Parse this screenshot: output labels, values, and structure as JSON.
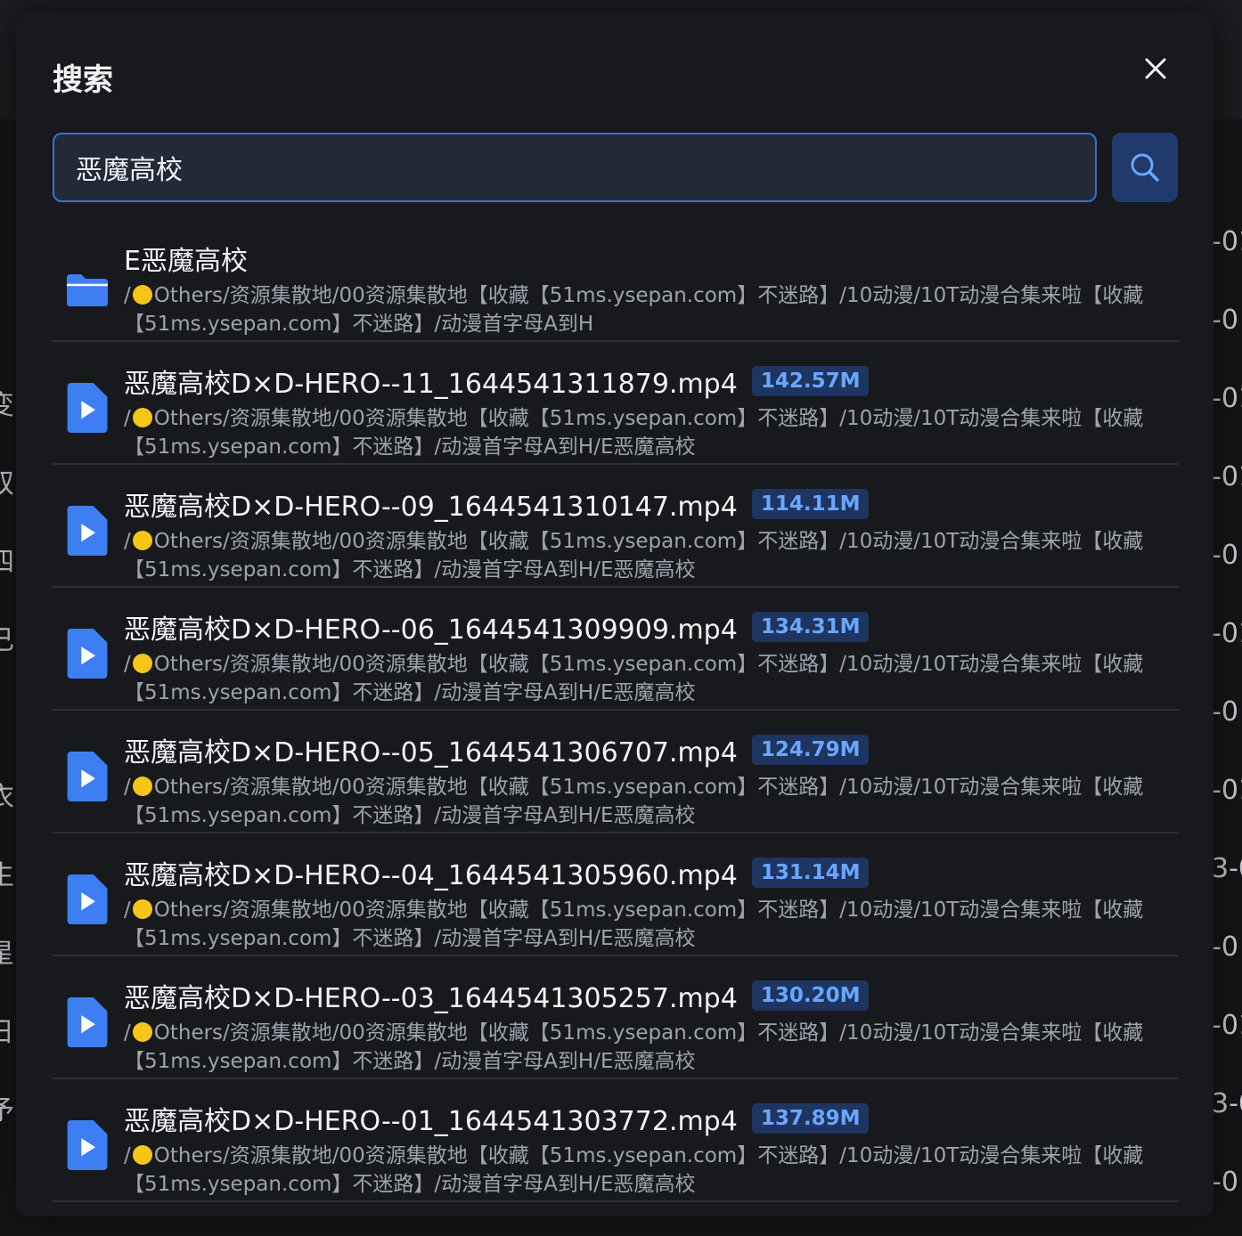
{
  "background": {
    "left_fragments": [
      "变",
      "双",
      "四",
      "己",
      "",
      "衣",
      "生",
      "星",
      "日",
      "予"
    ],
    "right_fragments": [
      "-01",
      "-0",
      "-01",
      "-01",
      "-0",
      "-01",
      "-0",
      "-01",
      "3-0",
      "-0",
      "-01",
      "3-0",
      "-0"
    ]
  },
  "modal": {
    "title": "搜索",
    "close_icon": "close-icon",
    "search": {
      "value": "恶魔高校",
      "placeholder": "",
      "button_icon": "search-icon"
    }
  },
  "colors": {
    "accent": "#3b6fd1",
    "badge_bg": "#1d3560",
    "badge_text": "#6aa6ff",
    "icon_blue": "#3d7ff2"
  },
  "results": [
    {
      "type": "folder",
      "icon": "folder-icon",
      "name": "E恶魔高校",
      "size": "",
      "path_prefix": "/",
      "path": "Others/资源集散地/00资源集散地【收藏【51ms.ysepan.com】不迷路】/10动漫/10T动漫合集来啦【收藏【51ms.ysepan.com】不迷路】/动漫首字母A到H"
    },
    {
      "type": "file",
      "icon": "video-file-icon",
      "name": "恶魔高校D×D-HERO--11_1644541311879.mp4",
      "size": "142.57M",
      "path_prefix": "/",
      "path": "Others/资源集散地/00资源集散地【收藏【51ms.ysepan.com】不迷路】/10动漫/10T动漫合集来啦【收藏【51ms.ysepan.com】不迷路】/动漫首字母A到H/E恶魔高校"
    },
    {
      "type": "file",
      "icon": "video-file-icon",
      "name": "恶魔高校D×D-HERO--09_1644541310147.mp4",
      "size": "114.11M",
      "path_prefix": "/",
      "path": "Others/资源集散地/00资源集散地【收藏【51ms.ysepan.com】不迷路】/10动漫/10T动漫合集来啦【收藏【51ms.ysepan.com】不迷路】/动漫首字母A到H/E恶魔高校"
    },
    {
      "type": "file",
      "icon": "video-file-icon",
      "name": "恶魔高校D×D-HERO--06_1644541309909.mp4",
      "size": "134.31M",
      "path_prefix": "/",
      "path": "Others/资源集散地/00资源集散地【收藏【51ms.ysepan.com】不迷路】/10动漫/10T动漫合集来啦【收藏【51ms.ysepan.com】不迷路】/动漫首字母A到H/E恶魔高校"
    },
    {
      "type": "file",
      "icon": "video-file-icon",
      "name": "恶魔高校D×D-HERO--05_1644541306707.mp4",
      "size": "124.79M",
      "path_prefix": "/",
      "path": "Others/资源集散地/00资源集散地【收藏【51ms.ysepan.com】不迷路】/10动漫/10T动漫合集来啦【收藏【51ms.ysepan.com】不迷路】/动漫首字母A到H/E恶魔高校"
    },
    {
      "type": "file",
      "icon": "video-file-icon",
      "name": "恶魔高校D×D-HERO--04_1644541305960.mp4",
      "size": "131.14M",
      "path_prefix": "/",
      "path": "Others/资源集散地/00资源集散地【收藏【51ms.ysepan.com】不迷路】/10动漫/10T动漫合集来啦【收藏【51ms.ysepan.com】不迷路】/动漫首字母A到H/E恶魔高校"
    },
    {
      "type": "file",
      "icon": "video-file-icon",
      "name": "恶魔高校D×D-HERO--03_1644541305257.mp4",
      "size": "130.20M",
      "path_prefix": "/",
      "path": "Others/资源集散地/00资源集散地【收藏【51ms.ysepan.com】不迷路】/10动漫/10T动漫合集来啦【收藏【51ms.ysepan.com】不迷路】/动漫首字母A到H/E恶魔高校"
    },
    {
      "type": "file",
      "icon": "video-file-icon",
      "name": "恶魔高校D×D-HERO--01_1644541303772.mp4",
      "size": "137.89M",
      "path_prefix": "/",
      "path": "Others/资源集散地/00资源集散地【收藏【51ms.ysepan.com】不迷路】/10动漫/10T动漫合集来啦【收藏【51ms.ysepan.com】不迷路】/动漫首字母A到H/E恶魔高校"
    }
  ]
}
